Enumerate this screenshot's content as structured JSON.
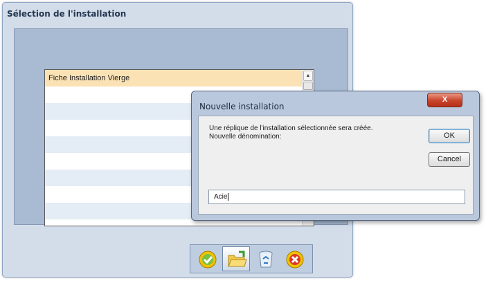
{
  "outer_window": {
    "title": "Sélection de l'installation"
  },
  "list": {
    "items": [
      {
        "label": "Fiche Installation Vierge",
        "selected": true
      },
      {
        "label": ""
      },
      {
        "label": ""
      },
      {
        "label": ""
      },
      {
        "label": ""
      },
      {
        "label": ""
      },
      {
        "label": ""
      },
      {
        "label": ""
      },
      {
        "label": ""
      }
    ]
  },
  "toolbar": {
    "buttons": [
      {
        "icon": "check-circle-icon"
      },
      {
        "icon": "open-folder-icon"
      },
      {
        "icon": "recycle-bin-icon"
      },
      {
        "icon": "cancel-circle-icon"
      }
    ]
  },
  "dialog": {
    "title": "Nouvelle installation",
    "close_label": "X",
    "message": "Une réplique de l'installation sélectionnée sera créée. Nouvelle dénomination:",
    "ok_label": "OK",
    "cancel_label": "Cancel",
    "input_value": "Acie"
  },
  "colors": {
    "window_bg": "#d3ddea",
    "panel_bg": "#a9bbd3",
    "selected_row": "#fbe2b5",
    "close_button": "#c9432b"
  }
}
